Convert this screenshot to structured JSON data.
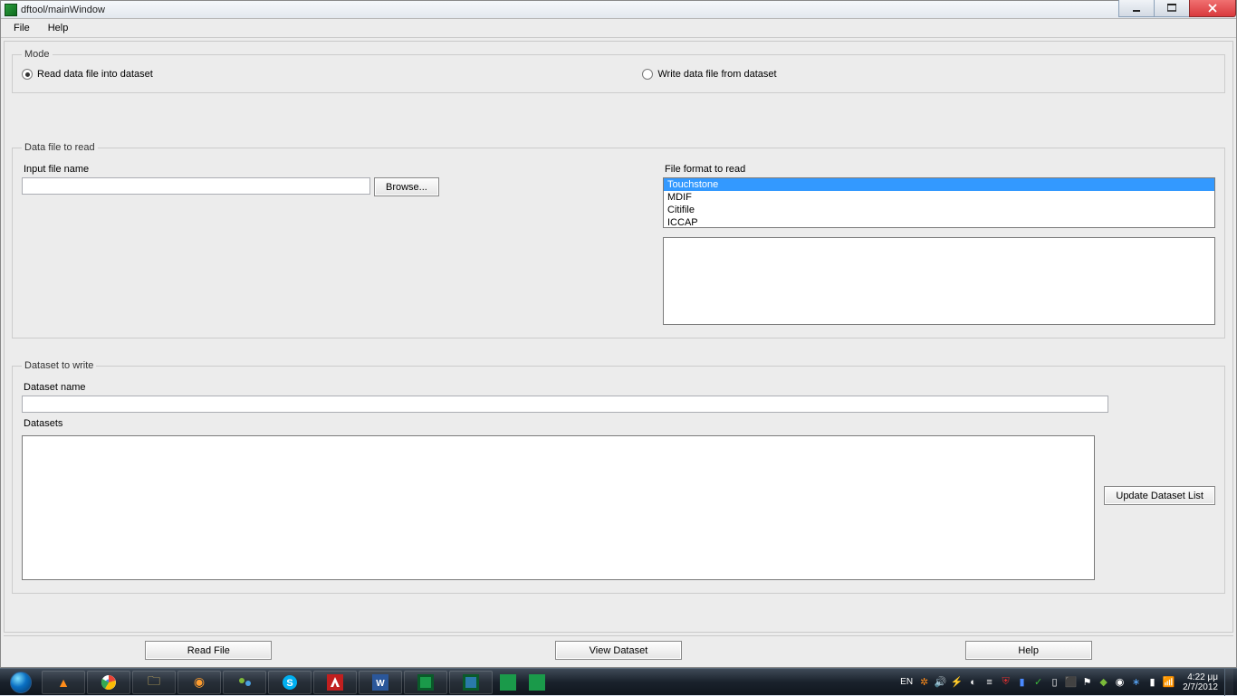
{
  "window": {
    "title": "dftool/mainWindow",
    "controls": {
      "min": "_",
      "max": "▭",
      "close": "✕"
    }
  },
  "menubar": [
    "File",
    "Help"
  ],
  "mode": {
    "legend": "Mode",
    "read_label": "Read data file into dataset",
    "write_label": "Write data file from dataset",
    "selected": "read"
  },
  "dfread": {
    "legend": "Data file to read",
    "input_label": "Input file name",
    "input_value": "",
    "browse_label": "Browse...",
    "format_label": "File format to read",
    "formats": [
      "Touchstone",
      "MDIF",
      "Citifile",
      "ICCAP"
    ],
    "format_selected": "Touchstone"
  },
  "dswrite": {
    "legend": "Dataset to write",
    "name_label": "Dataset name",
    "name_value": "",
    "list_label": "Datasets",
    "update_label": "Update Dataset List"
  },
  "footer": {
    "read_file": "Read File",
    "view_dataset": "View Dataset",
    "help": "Help"
  },
  "taskbar": {
    "lang": "EN",
    "time": "4:22 μμ",
    "date": "2/7/2012"
  }
}
